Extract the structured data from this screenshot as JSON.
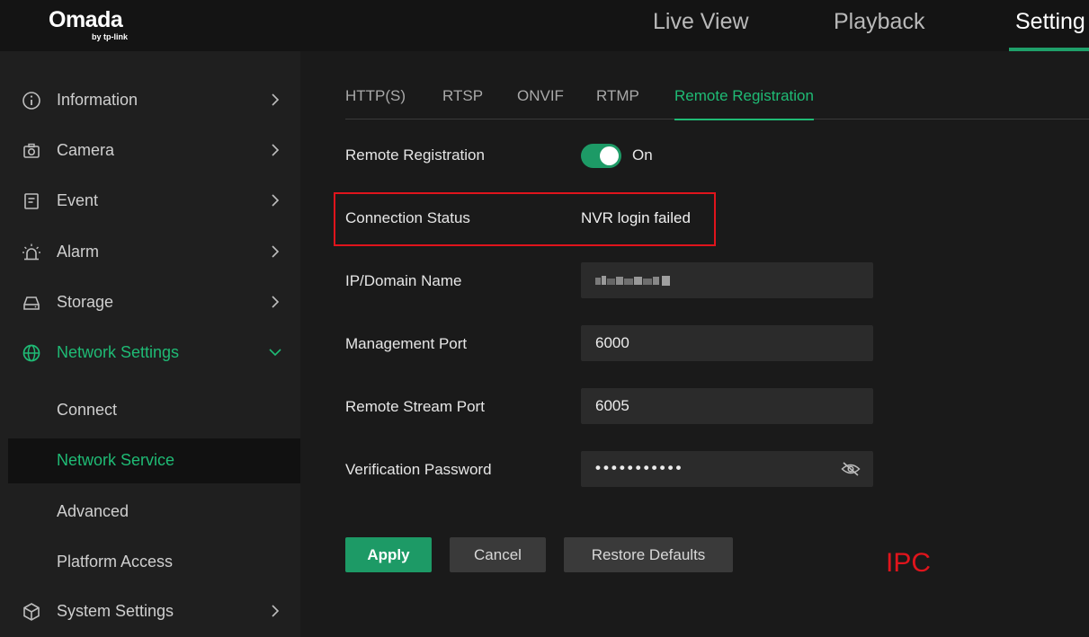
{
  "brand": {
    "logo_main": "Omada",
    "logo_sub": "by tp-link"
  },
  "nav": {
    "tabs": [
      {
        "label": "Live View"
      },
      {
        "label": "Playback"
      },
      {
        "label": "Setting"
      }
    ],
    "active": "Setting"
  },
  "sidebar": {
    "items": [
      {
        "label": "Information",
        "icon": "info-icon"
      },
      {
        "label": "Camera",
        "icon": "camera-icon"
      },
      {
        "label": "Event",
        "icon": "event-icon"
      },
      {
        "label": "Alarm",
        "icon": "alarm-icon"
      },
      {
        "label": "Storage",
        "icon": "storage-icon"
      },
      {
        "label": "Network Settings",
        "icon": "globe-icon"
      }
    ],
    "subitems": [
      {
        "label": "Connect"
      },
      {
        "label": "Network Service"
      },
      {
        "label": "Advanced"
      },
      {
        "label": "Platform Access"
      }
    ],
    "system": {
      "label": "System Settings",
      "icon": "cube-icon"
    }
  },
  "tabs": [
    {
      "label": "HTTP(S)"
    },
    {
      "label": "RTSP"
    },
    {
      "label": "ONVIF"
    },
    {
      "label": "RTMP"
    },
    {
      "label": "Remote Registration"
    }
  ],
  "form": {
    "remote_registration": {
      "label": "Remote Registration",
      "state": "On"
    },
    "connection_status": {
      "label": "Connection Status",
      "value": "NVR login failed"
    },
    "ip_domain": {
      "label": "IP/Domain Name"
    },
    "management_port": {
      "label": "Management Port",
      "value": "6000"
    },
    "remote_stream_port": {
      "label": "Remote Stream Port",
      "value": "6005"
    },
    "verification_password": {
      "label": "Verification Password",
      "masked": "•••••••••••"
    }
  },
  "buttons": {
    "apply": "Apply",
    "cancel": "Cancel",
    "restore": "Restore Defaults"
  },
  "annotation": {
    "note": "IPC"
  },
  "colors": {
    "accent": "#1fbb75",
    "highlight": "#e0141c",
    "toggle_on": "#1d9a66"
  }
}
